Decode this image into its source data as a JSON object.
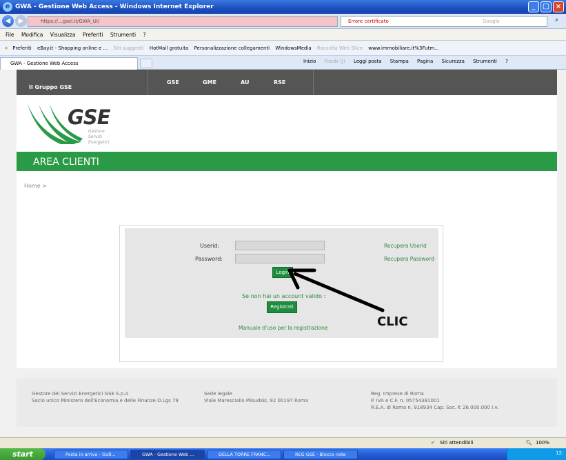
{
  "window": {
    "title": "GWA - Gestione Web Access - Windows Internet Explorer"
  },
  "addressbar": {
    "url": "https://...gsel.it/GWA_UI/",
    "cert_error": "Errore certificato",
    "search_placeholder": "Google"
  },
  "menu": [
    "File",
    "Modifica",
    "Visualizza",
    "Preferiti",
    "Strumenti",
    "?"
  ],
  "favorites": {
    "label": "Preferiti",
    "items": [
      "eBay.it - Shopping online e ...",
      "Siti suggeriti",
      "HotMail gratuita",
      "Personalizzazione collegamenti",
      "WindowsMedia",
      "Raccolta Web Slice",
      "www.immobiliare.it%3Futm..."
    ]
  },
  "tab": {
    "label": "GWA - Gestione Web Access"
  },
  "commandbar": [
    "Inizio",
    "Feeds (J)",
    "Leggi posta",
    "Stampa",
    "Pagina",
    "Sicurezza",
    "Strumenti",
    "?"
  ],
  "gse_nav": {
    "group_label": "Il Gruppo GSE",
    "links": [
      "GSE",
      "GME",
      "AU",
      "RSE"
    ]
  },
  "logo": {
    "text": "GSE",
    "sub": [
      "Gestore",
      "Servizi",
      "Energetici"
    ]
  },
  "area_title": "AREA CLIENTI",
  "breadcrumb": "Home >",
  "login": {
    "userid_label": "Userid:",
    "password_label": "Password:",
    "login_button": "Login",
    "recover_userid": "Recupera Userid",
    "recover_password": "Recupera Password",
    "no_account": "Se non hai un account valido :",
    "register_button": "Registrati",
    "manual_link": "Manuale d'uso per la registrazione"
  },
  "annotation": {
    "text": "CLIC"
  },
  "footer": {
    "col1": [
      "Gestore dei Servizi Energetici GSE S.p.A",
      "Socio unico Ministero dell'Economia e delle Finanze D.Lgs 79"
    ],
    "col2": [
      "Sede legale",
      "Viale Maresciallo Pilsudski, 92 00197 Roma"
    ],
    "col3": [
      "Reg. Imprese di Roma",
      "P. IVA e C.F. n. 05754381001",
      "R.E.A. di Roma n. 918934 Cap. Soc. € 26.000.000 i.v."
    ]
  },
  "statusbar": {
    "zone": "Siti attendibili",
    "zoom": "100%"
  },
  "taskbar": {
    "start": "start",
    "items": [
      "Posta in arrivo - Outl...",
      "GWA - Gestione Web ...",
      "DELLA TORRE FRANC...",
      "REG GSE - Blocco note"
    ],
    "time": "12:"
  },
  "colors": {
    "gse_green": "#2a9a47",
    "nav_gray": "#555555",
    "link_green": "#2d8a3c"
  }
}
